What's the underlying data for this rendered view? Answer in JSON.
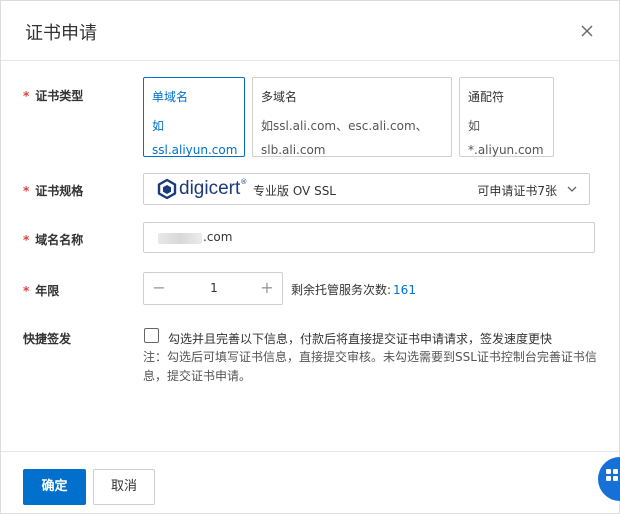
{
  "dialog": {
    "title": "证书申请"
  },
  "form": {
    "cert_type": {
      "label": "证书类型",
      "options": [
        {
          "title": "单域名",
          "desc": "如ssl.aliyun.com",
          "selected": true
        },
        {
          "title": "多域名",
          "desc": "如ssl.ali.com、esc.ali.com、slb.ali.com",
          "selected": false
        },
        {
          "title": "通配符",
          "desc": "如*.aliyun.com",
          "selected": false
        }
      ]
    },
    "cert_spec": {
      "label": "证书规格",
      "brand": "digicert",
      "brand_mark": "®",
      "product": "专业版 OV SSL",
      "quota": "可申请证书7张"
    },
    "domain": {
      "label": "域名名称",
      "value_suffix": ".com"
    },
    "years": {
      "label": "年限",
      "value": "1",
      "minus": "−",
      "plus": "+",
      "remain_label": "剩余托管服务次数:",
      "remain_value": "161"
    },
    "quick_issue": {
      "label": "快捷签发",
      "checked": false,
      "text": "勾选并且完善以下信息，付款后将直接提交证书申请请求，签发速度更快",
      "note": "注：勾选后可填写证书信息，直接提交审核。未勾选需要到SSL证书控制台完善证书信息，提交证书申请。"
    }
  },
  "footer": {
    "ok_label": "确定",
    "cancel_label": "取消"
  },
  "colors": {
    "accent": "#0070cc",
    "required": "#e04040",
    "brand": "#1a3a7a"
  }
}
